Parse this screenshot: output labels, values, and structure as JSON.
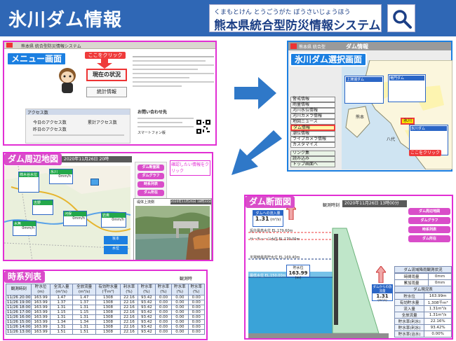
{
  "header": {
    "title": "氷川ダム情報",
    "system_kana": "くまもとけん とうごうがた ぼうさいじょうほう",
    "system_name": "熊本県統合型防災情報システム"
  },
  "menu_panel": {
    "label": "メニュー画面",
    "app_title": "熊本県 統合型防災情報システム",
    "click_here": "ここをクリック",
    "current_status_button": "現在の状況",
    "stats_button": "統計情報",
    "access_title": "アクセス数",
    "today_label": "今日のアクセス数",
    "yesterday_label": "昨日のアクセス数",
    "total_label": "累計アクセス数",
    "contact_title": "お問い合わせ先",
    "smartphone_label": "スマートフォン版"
  },
  "select_panel": {
    "label": "氷川ダム選択画面",
    "screen_title": "ダム情報",
    "app_title": "熊本県 統合型",
    "menu_items": [
      "警戒情報",
      "雨量情報",
      "河川水位情報",
      "河川カメラ情報",
      "地図ニュース",
      "ダム情報",
      "潮位情報",
      "ライブカメラ情報",
      "カスタマイズ"
    ],
    "extra_items": [
      "リンク集",
      "読み込み",
      "トップ画面へ"
    ],
    "active_item": "ダム情報",
    "click_here": "ここをクリック",
    "dam_marker": "氷川",
    "place_1": "熊本",
    "place_2": "八代",
    "box_1_title": "上津浦ダム",
    "box_2_title": "竜門ダム",
    "box_3_title": "氷川ダム"
  },
  "area_panel": {
    "label": "ダム周辺地図",
    "datetime": "2020年11月26日 20時",
    "hint": "確認したい情報をクリック",
    "side_buttons": [
      "ダム断面図",
      "ダムグラフ",
      "時系列表",
      "ダム所在"
    ],
    "station_1": "柿木谷水位",
    "station_2": "氷川",
    "station_3": "河俣",
    "station_4": "水無",
    "station_5": "吉野",
    "station_6": "岩奥",
    "zero_reading": "0mm/h",
    "blue_box_1": "坂本",
    "blue_box_2": "水位",
    "camera_title": "堤体上流側",
    "camera_time": "2020年11月26日 18時33分"
  },
  "cross_panel": {
    "label": "ダム断面図",
    "observed_label": "観測時刻",
    "datetime": "2020年11月26日 13時00分",
    "inflow_title": "ダムへの流入量",
    "inflow_value": "1.31",
    "outflow_value": "1.31",
    "unit_flow": "(m³/s)",
    "level_title": "貯水位",
    "level_value": "163.99",
    "unit_level": "(m)",
    "outflow_title": "ダムからの放流量",
    "levels": [
      "設計最高水位 EL.179.60m",
      "サーチャージ水位 EL.179.00m",
      "平常時最高貯水位 EL.169.40m",
      "最低水位 EL.150.00m"
    ],
    "side_buttons": [
      "ダム周辺地図",
      "ダムグラフ",
      "時系列表",
      "ダム所在"
    ],
    "basin_title": "ダム流域降雨観測状況",
    "basin_rows": [
      [
        "時間雨量",
        "0mm"
      ],
      [
        "累加雨量",
        "0mm"
      ]
    ],
    "status_title": "ダム現況表",
    "status_rows": [
      [
        "貯水位",
        "163.99m"
      ],
      [
        "有効貯水量",
        "1,308千m³"
      ],
      [
        "流入量",
        "1.31m³/s"
      ],
      [
        "全放流量",
        "1.31m³/s"
      ],
      [
        "貯水率(利水)",
        "22.16%"
      ],
      [
        "貯水率(利水)",
        "93.42%"
      ],
      [
        "貯水率(治水)",
        "0.00%"
      ]
    ]
  },
  "time_panel": {
    "label": "時系列表",
    "observed_label": "観測時",
    "headers": [
      "観測時刻",
      "貯水位(m)",
      "全流入量(m³/s)",
      "全放流量(m³/s)",
      "有効貯水量(千m³)",
      "利水率(%)",
      "貯水率(%)",
      "貯水率(%)",
      "貯水率(%)",
      "貯水率(%)"
    ],
    "rows": [
      [
        "11/26 20:00",
        "163.99",
        "1.47",
        "1.47",
        "1308",
        "22.16",
        "93.42",
        "0.00",
        "0.00",
        "0.00"
      ],
      [
        "11/26 19:00",
        "163.99",
        "1.37",
        "1.37",
        "1308",
        "22.16",
        "93.42",
        "0.00",
        "0.00",
        "0.00"
      ],
      [
        "11/26 18:00",
        "163.99",
        "1.31",
        "1.31",
        "1308",
        "22.16",
        "93.42",
        "0.00",
        "0.00",
        "0.00"
      ],
      [
        "11/26 17:00",
        "163.99",
        "1.15",
        "1.15",
        "1308",
        "22.16",
        "93.42",
        "0.00",
        "0.00",
        "0.00"
      ],
      [
        "11/26 16:00",
        "163.99",
        "1.31",
        "1.31",
        "1308",
        "22.16",
        "93.42",
        "0.00",
        "0.00",
        "0.00"
      ],
      [
        "11/26 15:00",
        "163.99",
        "1.34",
        "1.34",
        "1308",
        "22.16",
        "93.42",
        "0.00",
        "0.00",
        "0.00"
      ],
      [
        "11/26 14:00",
        "163.99",
        "1.31",
        "1.31",
        "1308",
        "22.16",
        "93.42",
        "0.00",
        "0.00",
        "0.00"
      ],
      [
        "11/26 13:00",
        "163.99",
        "1.51",
        "1.51",
        "1308",
        "22.16",
        "93.42",
        "0.00",
        "0.00",
        "0.00"
      ]
    ]
  },
  "colors": {
    "header_blue": "#2f67b5",
    "panel_magenta": "#e22fd4",
    "pill_blue": "#1b7fe1",
    "accent_red": "#ef3b3b",
    "arrow_blue": "#2f78c8"
  }
}
